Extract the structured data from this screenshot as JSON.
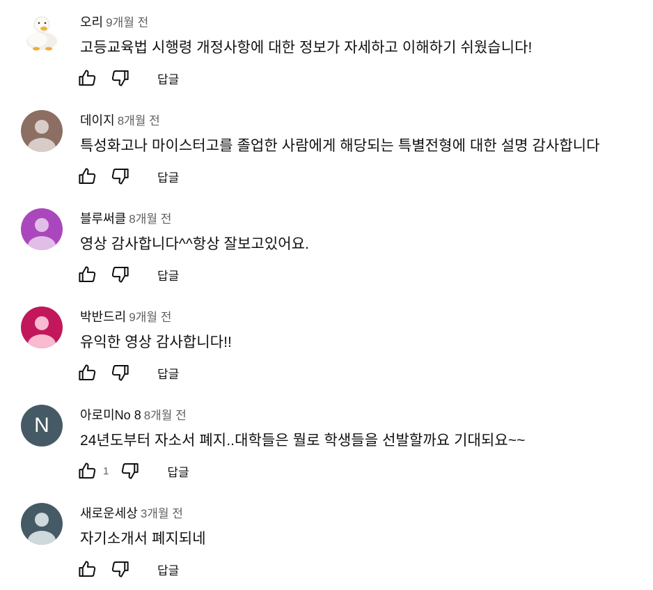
{
  "comments": [
    {
      "author": "오리",
      "time": "9개월 전",
      "text": "고등교육법 시행령 개정사항에 대한 정보가 자세하고 이해하기 쉬웠습니다!",
      "avatar": {
        "type": "image",
        "icon": "duck-plush-photo"
      },
      "likes": "",
      "reply_label": "답글"
    },
    {
      "author": "데이지",
      "time": "8개월 전",
      "text": "특성화고나 마이스터고를 졸업한 사람에게 해당되는 특별전형에 대한 설명 감사합니다",
      "avatar": {
        "type": "default",
        "bg": "#8d6e63",
        "fg": "#d7ccc8"
      },
      "likes": "",
      "reply_label": "답글"
    },
    {
      "author": "블루써클",
      "time": "8개월 전",
      "text": "영상 감사합니다^^항상 잘보고있어요.",
      "avatar": {
        "type": "default",
        "bg": "#ab47bc",
        "fg": "#e1bee7"
      },
      "likes": "",
      "reply_label": "답글"
    },
    {
      "author": "박반드리",
      "time": "9개월 전",
      "text": "유익한 영상 감사합니다!!",
      "avatar": {
        "type": "default",
        "bg": "#c2185b",
        "fg": "#f8bbd0"
      },
      "likes": "",
      "reply_label": "답글"
    },
    {
      "author": "아로미No 8",
      "time": "8개월 전",
      "text": "24년도부터 자소서 폐지..대학들은 뭘로 학생들을 선발할까요 기대되요~~",
      "avatar": {
        "type": "letter",
        "letter": "N",
        "bg": "#455a64"
      },
      "likes": "1",
      "reply_label": "답글"
    },
    {
      "author": "새로운세상",
      "time": "3개월 전",
      "text": "자기소개서 폐지되네",
      "avatar": {
        "type": "default",
        "bg": "#455a64",
        "fg": "#cfd8dc"
      },
      "likes": "",
      "reply_label": "답글"
    }
  ],
  "icons": {
    "like": "thumb-up-icon",
    "dislike": "thumb-down-icon"
  }
}
